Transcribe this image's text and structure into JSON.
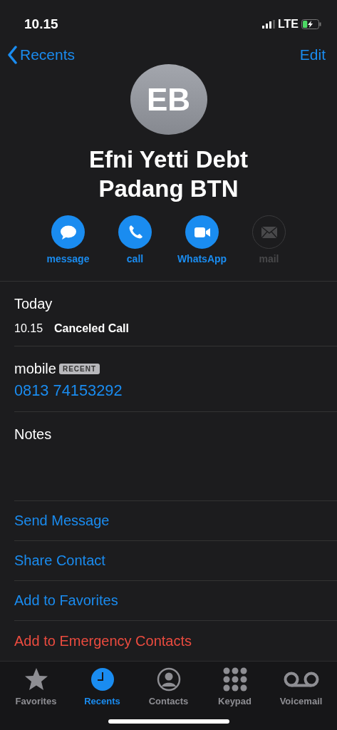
{
  "status_bar": {
    "time": "10.15",
    "network": "LTE",
    "charging": true
  },
  "nav": {
    "back": "Recents",
    "edit": "Edit"
  },
  "contact": {
    "initials": "EB",
    "name_lines": [
      "Efni Yetti Debt",
      "Padang BTN"
    ]
  },
  "actions": [
    {
      "kind": "message",
      "label": "message",
      "disabled": false
    },
    {
      "kind": "call",
      "label": "call",
      "disabled": false
    },
    {
      "kind": "video",
      "label": "WhatsApp",
      "disabled": false
    },
    {
      "kind": "mail",
      "label": "mail",
      "disabled": true
    }
  ],
  "recent_calls": {
    "heading": "Today",
    "time": "10.15",
    "type": "Canceled Call"
  },
  "phone": {
    "label": "mobile",
    "badge": "RECENT",
    "number": "0813 74153292"
  },
  "notes": {
    "label": "Notes"
  },
  "links": [
    {
      "label": "Send Message",
      "destructive": false
    },
    {
      "label": "Share Contact",
      "destructive": false
    },
    {
      "label": "Add to Favorites",
      "destructive": false
    },
    {
      "label": "Add to Emergency Contacts",
      "destructive": true
    }
  ],
  "tabs": [
    {
      "kind": "star",
      "label": "Favorites",
      "selected": false
    },
    {
      "kind": "clock",
      "label": "Recents",
      "selected": true
    },
    {
      "kind": "person",
      "label": "Contacts",
      "selected": false
    },
    {
      "kind": "keypad",
      "label": "Keypad",
      "selected": false
    },
    {
      "kind": "voicemail",
      "label": "Voicemail",
      "selected": false
    }
  ]
}
